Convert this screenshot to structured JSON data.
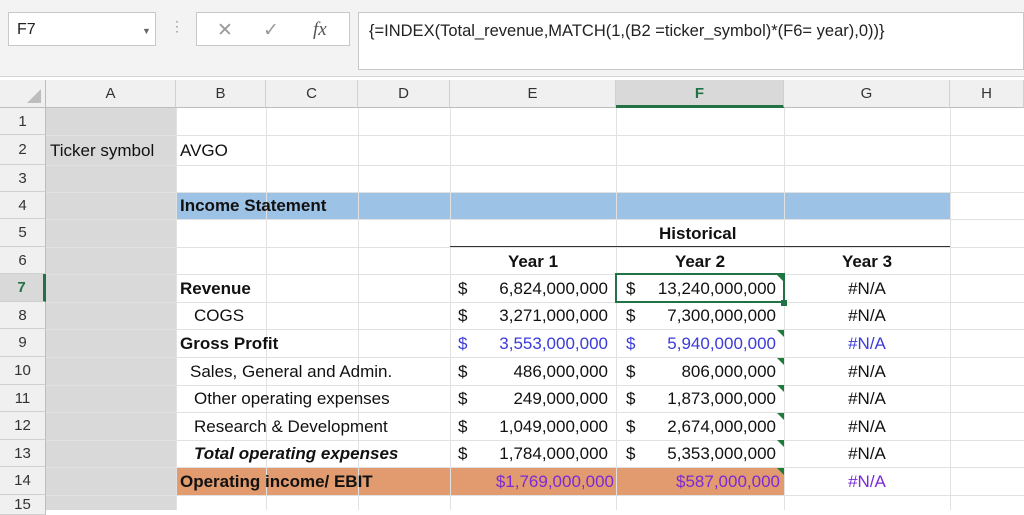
{
  "formula_bar": {
    "name_box": "F7",
    "cancel_symbol": "✕",
    "enter_symbol": "✓",
    "fx_symbol": "fx",
    "formula": "{=INDEX(Total_revenue,MATCH(1,(B2 =ticker_symbol)*(F6= year),0))}"
  },
  "columns": [
    "A",
    "B",
    "C",
    "D",
    "E",
    "F",
    "G",
    "H"
  ],
  "rows": [
    "1",
    "2",
    "3",
    "4",
    "5",
    "6",
    "7",
    "8",
    "9",
    "10",
    "11",
    "12",
    "13",
    "14",
    "15"
  ],
  "active_cell": "F7",
  "cells": {
    "a2": "Ticker symbol",
    "b2": "AVGO",
    "b4": "Income Statement",
    "f5": "Historical",
    "e6": "Year 1",
    "f6": "Year 2",
    "g6": "Year 3",
    "b7": "Revenue",
    "b8": "COGS",
    "b9": "Gross Profit",
    "b10": "Sales, General and Admin.",
    "b11": "Other operating expenses",
    "b12": "Research & Development",
    "b13": "Total operating expenses",
    "b14": "Operating income/ EBIT",
    "currency": "$",
    "e7": "6,824,000,000",
    "f7": "13,240,000,000",
    "g7": "#N/A",
    "e8": "3,271,000,000",
    "f8": "7,300,000,000",
    "g8": "#N/A",
    "e9": "3,553,000,000",
    "f9": "5,940,000,000",
    "g9": "#N/A",
    "e10": "486,000,000",
    "f10": "806,000,000",
    "g10": "#N/A",
    "e11": "249,000,000",
    "f11": "1,873,000,000",
    "g11": "#N/A",
    "e12": "1,049,000,000",
    "f12": "2,674,000,000",
    "g12": "#N/A",
    "e13": "1,784,000,000",
    "f13": "5,353,000,000",
    "g13": "#N/A",
    "e14": "$1,769,000,000",
    "f14": "$587,000,000",
    "g14": "#N/A"
  },
  "colors": {
    "header_band": "#9cc2e5",
    "ebit_band": "#e29b6e",
    "blue_text": "#3b3bd9",
    "purple_text": "#7a2ad6",
    "selection": "#217346"
  }
}
